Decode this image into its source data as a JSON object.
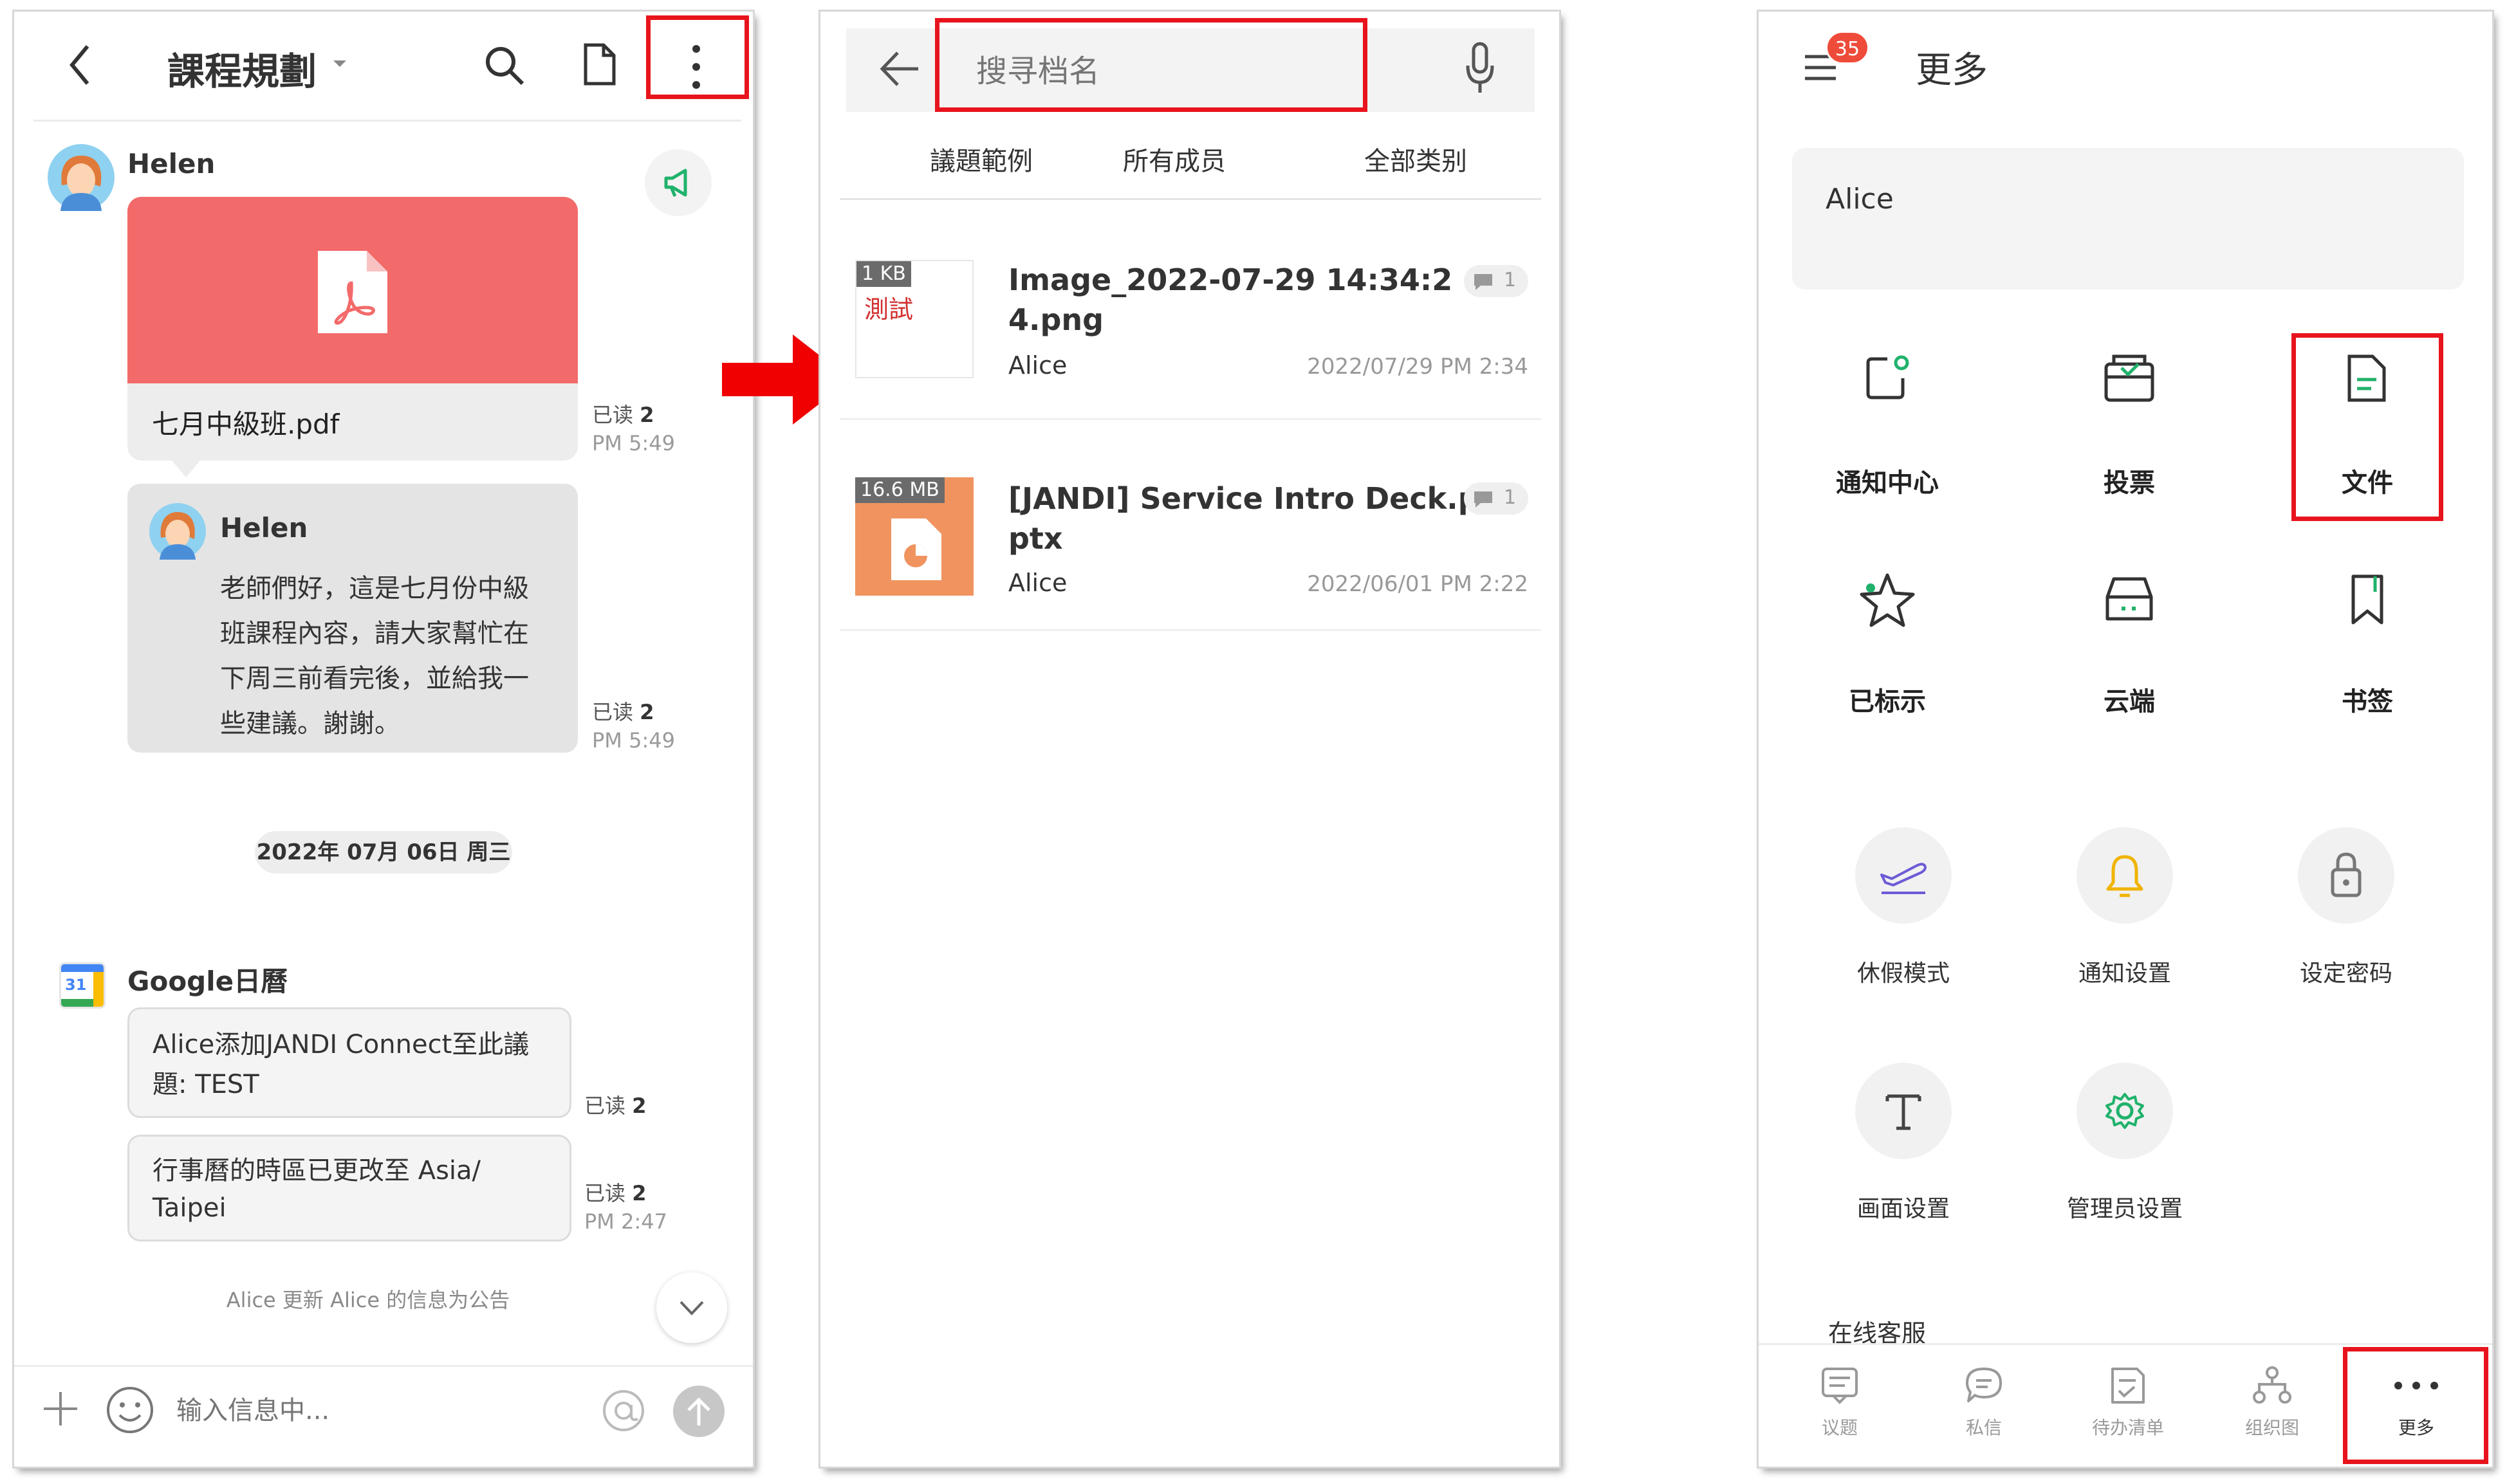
{
  "panel1": {
    "header": {
      "title": "課程規劃"
    },
    "messages": {
      "helen_name": "Helen",
      "file_name": "七月中級班.pdf",
      "file_read_label": "已读",
      "file_read_count": "2",
      "file_time": "PM 5:49",
      "quote_name": "Helen",
      "quote_lines": [
        "老師們好，這是七月份中級",
        "班課程內容，請大家幫忙在",
        "下周三前看完後，並給我一",
        "些建議。謝謝。"
      ],
      "quote_read_label": "已读",
      "quote_read_count": "2",
      "quote_time": "PM 5:49",
      "date_divider": "2022年 07月 06日 周三",
      "google_name": "Google日曆",
      "calendar_icon_text": "31",
      "msg1_lines": [
        "Alice添加JANDI Connect至此議",
        "題: TEST"
      ],
      "msg1_read_label": "已读",
      "msg1_read_count": "2",
      "msg2_lines": [
        "行事曆的時區已更改至 Asia/",
        "Taipei"
      ],
      "msg2_read_label": "已读",
      "msg2_read_count": "2",
      "msg2_time": "PM 2:47",
      "notice": "Alice 更新 Alice 的信息为公告"
    },
    "composer": {
      "placeholder": "输入信息中..."
    }
  },
  "panel2": {
    "search": {
      "placeholder": "搜寻档名"
    },
    "filters": [
      "議題範例",
      "所有成员",
      "全部类别"
    ],
    "files": [
      {
        "size": "1 KB",
        "thumb_text": "測試",
        "name_lines": [
          "Image_2022-07-29 14:34:2",
          "4.png"
        ],
        "owner": "Alice",
        "date": "2022/07/29 PM 2:34",
        "comments": "1"
      },
      {
        "size": "16.6 MB",
        "name_lines": [
          "[JANDI] Service Intro Deck.p",
          "ptx"
        ],
        "owner": "Alice",
        "date": "2022/06/01 PM 2:22",
        "comments": "1"
      }
    ]
  },
  "panel3": {
    "header": {
      "badge": "35",
      "title": "更多"
    },
    "profile": {
      "name": "Alice"
    },
    "grid": [
      "通知中心",
      "投票",
      "文件",
      "已标示",
      "云端",
      "书签"
    ],
    "settings": [
      "休假模式",
      "通知设置",
      "设定密码",
      "画面设置",
      "管理员设置"
    ],
    "support": "在线客服",
    "nav": [
      "议题",
      "私信",
      "待办清单",
      "组织图",
      "更多"
    ]
  },
  "colors": {
    "accent": "#20b26b",
    "highlight": "#e8141d",
    "pdf": "#f36a6a",
    "ppt": "#f0935f",
    "badge": "#ef4b3b"
  }
}
